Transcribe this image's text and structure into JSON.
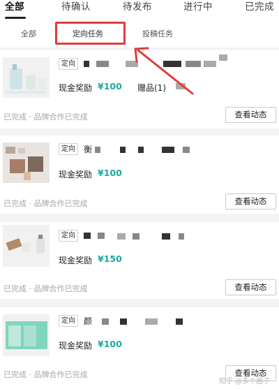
{
  "top_tabs": {
    "items": [
      {
        "label": "全部"
      },
      {
        "label": "待确认"
      },
      {
        "label": "待发布"
      },
      {
        "label": "进行中"
      },
      {
        "label": "已完成"
      }
    ]
  },
  "sub_tabs": {
    "items": [
      {
        "label": "全部"
      },
      {
        "label": "定向任务"
      },
      {
        "label": "投稿任务"
      }
    ]
  },
  "cards": [
    {
      "tag": "定向",
      "reward_label": "现金奖励",
      "reward_amount": "¥100",
      "gift_label": "赠品(1)",
      "status": "已完成 · 品牌合作已完成",
      "action_label": "查看动态"
    },
    {
      "tag": "定向",
      "title_initial": "衡",
      "reward_label": "现金奖励",
      "reward_amount": "¥100",
      "status": "已完成 · 品牌合作已完成",
      "action_label": "查看动态"
    },
    {
      "tag": "定向",
      "reward_label": "现金奖励",
      "reward_amount": "¥150",
      "status": "已完成 · 品牌合作已完成",
      "action_label": "查看动态"
    },
    {
      "tag": "定向",
      "title_initial": "颜",
      "reward_label": "现金奖励",
      "reward_amount": "¥100",
      "status": "已完成 · 品牌合作已完成",
      "action_label": "查看动态"
    }
  ],
  "watermark": "知乎 @多个圈子",
  "colors": {
    "accent": "#1aaa9c",
    "highlight": "#e03c3c",
    "muted_text": "#a5a5a5"
  }
}
